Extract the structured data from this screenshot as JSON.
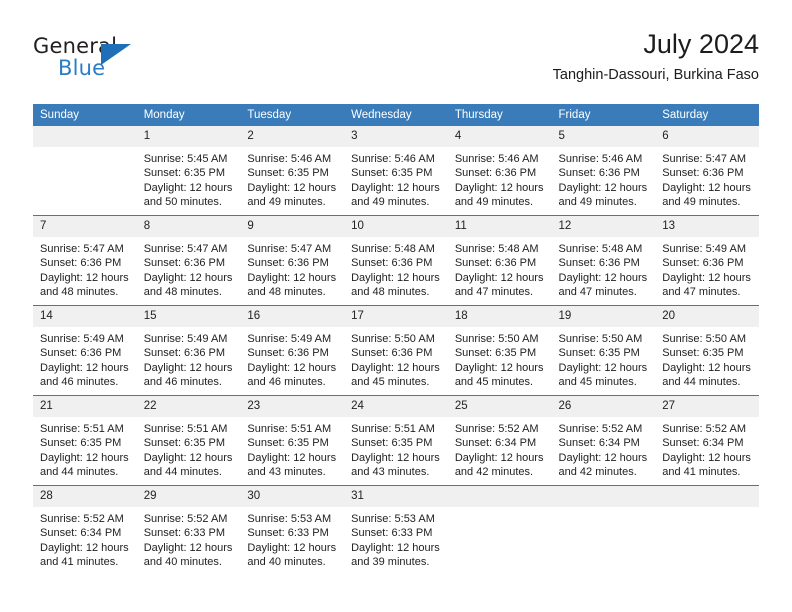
{
  "logo": {
    "word1": "General",
    "word2": "Blue",
    "triangle_color": "#1f6fb8",
    "blue_text_color": "#2a7cc7"
  },
  "header": {
    "title": "July 2024",
    "subtitle": "Tanghin-Dassouri, Burkina Faso"
  },
  "theme": {
    "header_bg": "#3a7cba",
    "daynum_bg": "#f0f0f0",
    "grid_line": "#3a7cba",
    "text": "#222222"
  },
  "weekday_headers": [
    "Sunday",
    "Monday",
    "Tuesday",
    "Wednesday",
    "Thursday",
    "Friday",
    "Saturday"
  ],
  "weeks": [
    [
      {
        "day": "",
        "empty": true,
        "sunrise": "",
        "sunset": "",
        "daylight1": "",
        "daylight2": ""
      },
      {
        "day": "1",
        "empty": false,
        "sunrise": "Sunrise: 5:45 AM",
        "sunset": "Sunset: 6:35 PM",
        "daylight1": "Daylight: 12 hours",
        "daylight2": "and 50 minutes."
      },
      {
        "day": "2",
        "empty": false,
        "sunrise": "Sunrise: 5:46 AM",
        "sunset": "Sunset: 6:35 PM",
        "daylight1": "Daylight: 12 hours",
        "daylight2": "and 49 minutes."
      },
      {
        "day": "3",
        "empty": false,
        "sunrise": "Sunrise: 5:46 AM",
        "sunset": "Sunset: 6:35 PM",
        "daylight1": "Daylight: 12 hours",
        "daylight2": "and 49 minutes."
      },
      {
        "day": "4",
        "empty": false,
        "sunrise": "Sunrise: 5:46 AM",
        "sunset": "Sunset: 6:36 PM",
        "daylight1": "Daylight: 12 hours",
        "daylight2": "and 49 minutes."
      },
      {
        "day": "5",
        "empty": false,
        "sunrise": "Sunrise: 5:46 AM",
        "sunset": "Sunset: 6:36 PM",
        "daylight1": "Daylight: 12 hours",
        "daylight2": "and 49 minutes."
      },
      {
        "day": "6",
        "empty": false,
        "sunrise": "Sunrise: 5:47 AM",
        "sunset": "Sunset: 6:36 PM",
        "daylight1": "Daylight: 12 hours",
        "daylight2": "and 49 minutes."
      }
    ],
    [
      {
        "day": "7",
        "empty": false,
        "sunrise": "Sunrise: 5:47 AM",
        "sunset": "Sunset: 6:36 PM",
        "daylight1": "Daylight: 12 hours",
        "daylight2": "and 48 minutes."
      },
      {
        "day": "8",
        "empty": false,
        "sunrise": "Sunrise: 5:47 AM",
        "sunset": "Sunset: 6:36 PM",
        "daylight1": "Daylight: 12 hours",
        "daylight2": "and 48 minutes."
      },
      {
        "day": "9",
        "empty": false,
        "sunrise": "Sunrise: 5:47 AM",
        "sunset": "Sunset: 6:36 PM",
        "daylight1": "Daylight: 12 hours",
        "daylight2": "and 48 minutes."
      },
      {
        "day": "10",
        "empty": false,
        "sunrise": "Sunrise: 5:48 AM",
        "sunset": "Sunset: 6:36 PM",
        "daylight1": "Daylight: 12 hours",
        "daylight2": "and 48 minutes."
      },
      {
        "day": "11",
        "empty": false,
        "sunrise": "Sunrise: 5:48 AM",
        "sunset": "Sunset: 6:36 PM",
        "daylight1": "Daylight: 12 hours",
        "daylight2": "and 47 minutes."
      },
      {
        "day": "12",
        "empty": false,
        "sunrise": "Sunrise: 5:48 AM",
        "sunset": "Sunset: 6:36 PM",
        "daylight1": "Daylight: 12 hours",
        "daylight2": "and 47 minutes."
      },
      {
        "day": "13",
        "empty": false,
        "sunrise": "Sunrise: 5:49 AM",
        "sunset": "Sunset: 6:36 PM",
        "daylight1": "Daylight: 12 hours",
        "daylight2": "and 47 minutes."
      }
    ],
    [
      {
        "day": "14",
        "empty": false,
        "sunrise": "Sunrise: 5:49 AM",
        "sunset": "Sunset: 6:36 PM",
        "daylight1": "Daylight: 12 hours",
        "daylight2": "and 46 minutes."
      },
      {
        "day": "15",
        "empty": false,
        "sunrise": "Sunrise: 5:49 AM",
        "sunset": "Sunset: 6:36 PM",
        "daylight1": "Daylight: 12 hours",
        "daylight2": "and 46 minutes."
      },
      {
        "day": "16",
        "empty": false,
        "sunrise": "Sunrise: 5:49 AM",
        "sunset": "Sunset: 6:36 PM",
        "daylight1": "Daylight: 12 hours",
        "daylight2": "and 46 minutes."
      },
      {
        "day": "17",
        "empty": false,
        "sunrise": "Sunrise: 5:50 AM",
        "sunset": "Sunset: 6:36 PM",
        "daylight1": "Daylight: 12 hours",
        "daylight2": "and 45 minutes."
      },
      {
        "day": "18",
        "empty": false,
        "sunrise": "Sunrise: 5:50 AM",
        "sunset": "Sunset: 6:35 PM",
        "daylight1": "Daylight: 12 hours",
        "daylight2": "and 45 minutes."
      },
      {
        "day": "19",
        "empty": false,
        "sunrise": "Sunrise: 5:50 AM",
        "sunset": "Sunset: 6:35 PM",
        "daylight1": "Daylight: 12 hours",
        "daylight2": "and 45 minutes."
      },
      {
        "day": "20",
        "empty": false,
        "sunrise": "Sunrise: 5:50 AM",
        "sunset": "Sunset: 6:35 PM",
        "daylight1": "Daylight: 12 hours",
        "daylight2": "and 44 minutes."
      }
    ],
    [
      {
        "day": "21",
        "empty": false,
        "sunrise": "Sunrise: 5:51 AM",
        "sunset": "Sunset: 6:35 PM",
        "daylight1": "Daylight: 12 hours",
        "daylight2": "and 44 minutes."
      },
      {
        "day": "22",
        "empty": false,
        "sunrise": "Sunrise: 5:51 AM",
        "sunset": "Sunset: 6:35 PM",
        "daylight1": "Daylight: 12 hours",
        "daylight2": "and 44 minutes."
      },
      {
        "day": "23",
        "empty": false,
        "sunrise": "Sunrise: 5:51 AM",
        "sunset": "Sunset: 6:35 PM",
        "daylight1": "Daylight: 12 hours",
        "daylight2": "and 43 minutes."
      },
      {
        "day": "24",
        "empty": false,
        "sunrise": "Sunrise: 5:51 AM",
        "sunset": "Sunset: 6:35 PM",
        "daylight1": "Daylight: 12 hours",
        "daylight2": "and 43 minutes."
      },
      {
        "day": "25",
        "empty": false,
        "sunrise": "Sunrise: 5:52 AM",
        "sunset": "Sunset: 6:34 PM",
        "daylight1": "Daylight: 12 hours",
        "daylight2": "and 42 minutes."
      },
      {
        "day": "26",
        "empty": false,
        "sunrise": "Sunrise: 5:52 AM",
        "sunset": "Sunset: 6:34 PM",
        "daylight1": "Daylight: 12 hours",
        "daylight2": "and 42 minutes."
      },
      {
        "day": "27",
        "empty": false,
        "sunrise": "Sunrise: 5:52 AM",
        "sunset": "Sunset: 6:34 PM",
        "daylight1": "Daylight: 12 hours",
        "daylight2": "and 41 minutes."
      }
    ],
    [
      {
        "day": "28",
        "empty": false,
        "sunrise": "Sunrise: 5:52 AM",
        "sunset": "Sunset: 6:34 PM",
        "daylight1": "Daylight: 12 hours",
        "daylight2": "and 41 minutes."
      },
      {
        "day": "29",
        "empty": false,
        "sunrise": "Sunrise: 5:52 AM",
        "sunset": "Sunset: 6:33 PM",
        "daylight1": "Daylight: 12 hours",
        "daylight2": "and 40 minutes."
      },
      {
        "day": "30",
        "empty": false,
        "sunrise": "Sunrise: 5:53 AM",
        "sunset": "Sunset: 6:33 PM",
        "daylight1": "Daylight: 12 hours",
        "daylight2": "and 40 minutes."
      },
      {
        "day": "31",
        "empty": false,
        "sunrise": "Sunrise: 5:53 AM",
        "sunset": "Sunset: 6:33 PM",
        "daylight1": "Daylight: 12 hours",
        "daylight2": "and 39 minutes."
      },
      {
        "day": "",
        "empty": true,
        "sunrise": "",
        "sunset": "",
        "daylight1": "",
        "daylight2": ""
      },
      {
        "day": "",
        "empty": true,
        "sunrise": "",
        "sunset": "",
        "daylight1": "",
        "daylight2": ""
      },
      {
        "day": "",
        "empty": true,
        "sunrise": "",
        "sunset": "",
        "daylight1": "",
        "daylight2": ""
      }
    ]
  ]
}
